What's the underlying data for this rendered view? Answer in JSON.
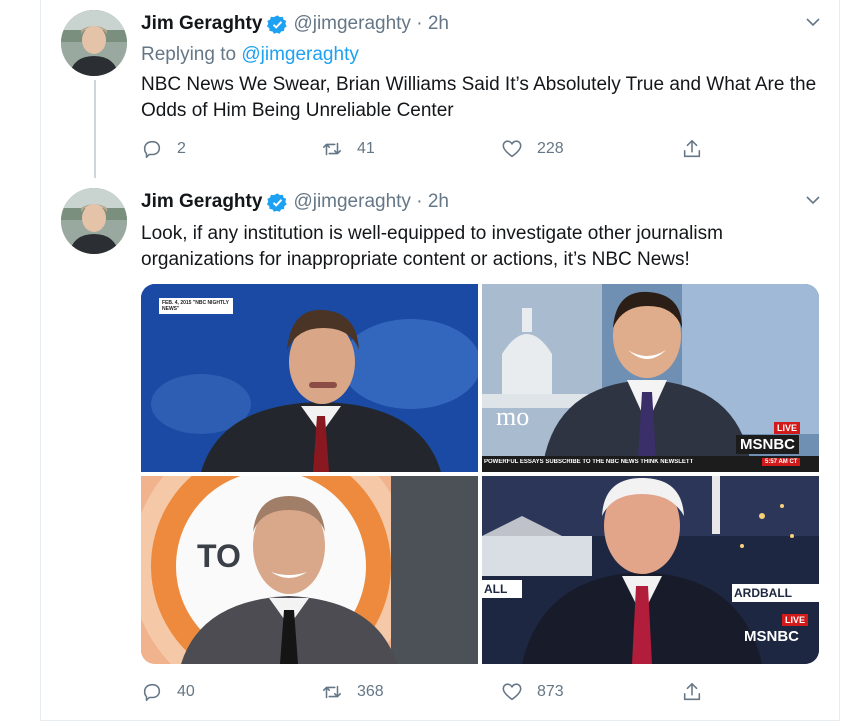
{
  "tweets": [
    {
      "name": "Jim Geraghty",
      "handle": "@jimgeraghty · 2h",
      "replying_prefix": "Replying to",
      "replying_to": "@jimgeraghty",
      "text": "NBC News We Swear, Brian Williams Said It’s Absolutely True and What Are the Odds of Him Being Unreliable Center",
      "replies": "2",
      "retweets": "41",
      "likes": "228"
    },
    {
      "name": "Jim Geraghty",
      "handle": "@jimgeraghty · 2h",
      "text": "Look, if any institution is well-equipped to investigate other journalism organizations for inappropriate content or actions, it’s NBC News!",
      "replies": "40",
      "retweets": "368",
      "likes": "873",
      "media": {
        "photo1_caption": "FEB. 4, 2015 \"NBC NIGHTLY NEWS\"",
        "photo2_bg_text": "mo",
        "photo2_brand": "MSNBC",
        "photo2_live": "LIVE",
        "photo2_ticker": "POWERFUL ESSAYS SUBSCRIBE TO THE NBC NEWS THINK NEWSLETT",
        "photo2_time": "5:57 AM CT",
        "photo3_bg_text": "TO",
        "photo4_left_text": "ALL",
        "photo4_right_text": "ARDBALL",
        "photo4_brand": "MSNBC",
        "photo4_live": "LIVE"
      }
    }
  ],
  "colors": {
    "accent": "#1da1f2",
    "secondary_text": "#657786",
    "verified": "#1da1f2",
    "msnbc_live": "#d11a1a"
  }
}
